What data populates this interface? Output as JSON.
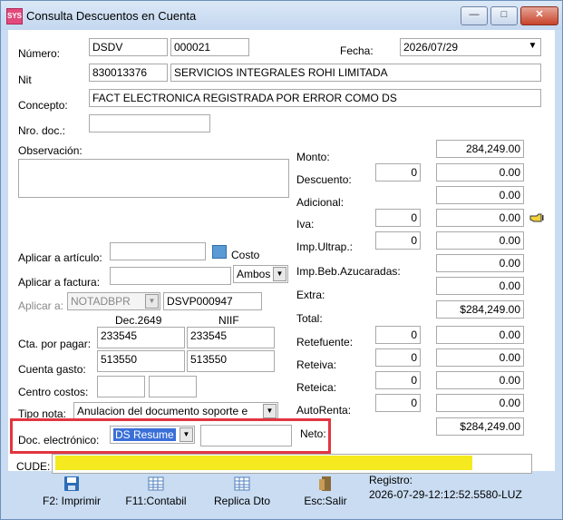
{
  "window": {
    "title": "Consulta Descuentos en Cuenta",
    "icon_text": "SYS"
  },
  "header": {
    "numero_label": "Número:",
    "numero_prefix": "DSDV",
    "numero_value": "000021",
    "fecha_label": "Fecha:",
    "fecha_value": "2026/07/29",
    "nit_label": "Nit",
    "nit_value": "830013376",
    "nit_name": "SERVICIOS INTEGRALES ROHI LIMITADA",
    "concepto_label": "Concepto:",
    "concepto_value": "FACT ELECTRONICA REGISTRADA POR ERROR COMO DS",
    "nrodoc_label": "Nro. doc.:",
    "nrodoc_value": "",
    "observacion_label": "Observación:",
    "observacion_value": ""
  },
  "aplicar": {
    "articulo_label": "Aplicar a artículo:",
    "articulo_value": "",
    "costo_label": "Costo",
    "ambos_value": "Ambos",
    "factura_label": "Aplicar a factura:",
    "factura_value": "",
    "a_label": "Aplicar a:",
    "a_combo": "NOTADBPR",
    "a_doc": "DSVP000947"
  },
  "cuentas": {
    "col1": "Dec.2649",
    "col2": "NIIF",
    "cta_pagar_label": "Cta. por pagar:",
    "cta_pagar_1": "233545",
    "cta_pagar_2": "233545",
    "cta_gasto_label": "Cuenta gasto:",
    "cta_gasto_1": "513550",
    "cta_gasto_2": "513550",
    "centro_label": "Centro costos:",
    "tipo_nota_label": "Tipo nota:",
    "tipo_nota_value": "Anulacion del documento soporte e",
    "doc_elec_label": "Doc. electrónico:",
    "doc_elec_value": "DS Resume",
    "doc_elec_extra": ""
  },
  "totales": {
    "monto_label": "Monto:",
    "monto": "284,249.00",
    "descuento_label": "Descuento:",
    "descuento_pct": "0",
    "descuento": "0.00",
    "adicional_label": "Adicional:",
    "adicional": "0.00",
    "iva_label": "Iva:",
    "iva_pct": "0",
    "iva": "0.00",
    "impultrap_label": "Imp.Ultrap.:",
    "impultrap_pct": "0",
    "impultrap": "0.00",
    "impbeb_label": "Imp.Beb.Azucaradas:",
    "impbeb": "0.00",
    "extra_label": "Extra:",
    "extra": "0.00",
    "total_label": "Total:",
    "total": "$284,249.00",
    "retefuente_label": "Retefuente:",
    "retefuente_pct": "0",
    "retefuente": "0.00",
    "reteiva_label": "Reteiva:",
    "reteiva_pct": "0",
    "reteiva": "0.00",
    "reteica_label": "Reteica:",
    "reteica_pct": "0",
    "reteica": "0.00",
    "autorenta_label": "AutoRenta:",
    "autorenta_pct": "0",
    "autorenta": "0.00",
    "neto_label": "Neto:",
    "neto": "$284,249.00"
  },
  "cude": {
    "label": "CUDE:",
    "value": ""
  },
  "toolbar": {
    "imprimir": "F2: Imprimir",
    "contabil": "F11:Contabil",
    "replica": "Replica Dto",
    "salir": "Esc:Salir",
    "registro_label": "Registro:",
    "registro_value": "2026-07-29-12:12:52.5580-LUZ"
  },
  "colors": {
    "highlight_box": "#e23540",
    "highlight_yellow": "#f4ea1f",
    "selection": "#3a6fd8"
  }
}
